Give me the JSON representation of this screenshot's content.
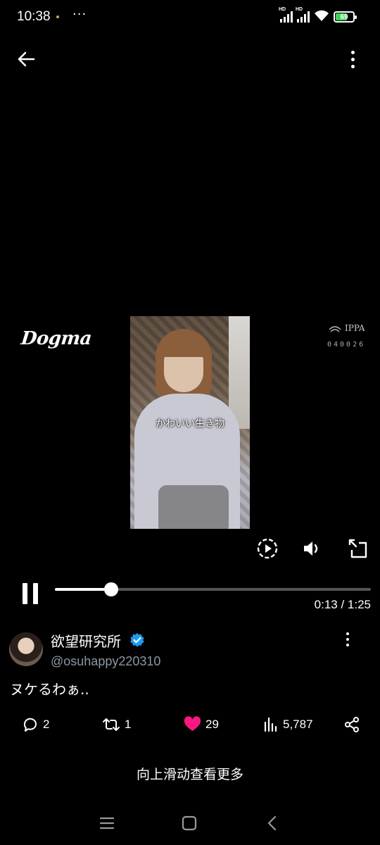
{
  "status_bar": {
    "time": "10:38",
    "more": "···",
    "signal1_label": "HD",
    "signal2_label": "HD",
    "battery_level": "69",
    "battery_color": "#3fd15b"
  },
  "top_bar": {
    "back_icon": "arrow-left-icon",
    "more_icon": "more-vertical-icon"
  },
  "video": {
    "caption": "かわいい生き物",
    "watermark_left": "Dogma",
    "watermark_right_name": "IPPA",
    "watermark_right_code": "040026",
    "elapsed": "0:13",
    "duration": "1:25",
    "time_readout": "0:13 / 1:25",
    "progress_fraction": 0.1784
  },
  "tweet": {
    "author_name": "欲望研究所",
    "verified": true,
    "handle": "@osuhappy220310",
    "text": "ヌケるわぁ..",
    "replies": "2",
    "retweets": "1",
    "likes": "29",
    "views": "5,787",
    "like_color": "#f91880",
    "verified_color": "#1d9bf0"
  },
  "swipe_hint": "向上滑动查看更多"
}
